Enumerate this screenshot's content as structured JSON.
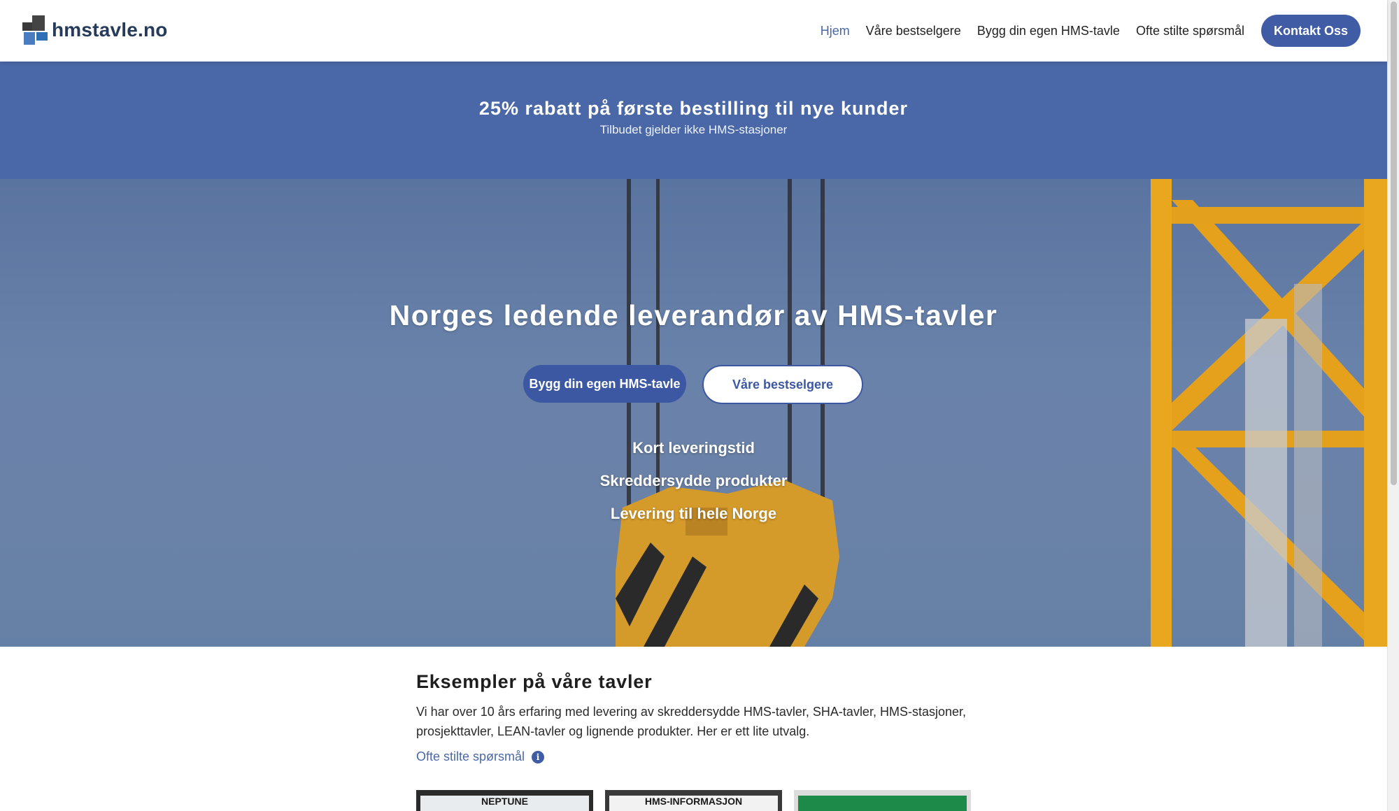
{
  "header": {
    "logo_text": "hmstavle.no",
    "nav": [
      {
        "label": "Hjem",
        "active": true
      },
      {
        "label": "Våre bestselgere",
        "active": false
      },
      {
        "label": "Bygg din egen HMS-tavle",
        "active": false
      },
      {
        "label": "Ofte stilte spørsmål",
        "active": false
      }
    ],
    "cta_label": "Kontakt Oss"
  },
  "promo": {
    "title": "25% rabatt på første bestilling til nye kunder",
    "subtitle": "Tilbudet gjelder ikke HMS-stasjoner"
  },
  "hero": {
    "title": "Norges ledende leverandør av HMS-tavler",
    "primary_button": "Bygg din egen HMS-tavle",
    "secondary_button": "Våre bestselgere",
    "features": [
      "Kort leveringstid",
      "Skreddersydde produkter",
      "Levering til hele Norge"
    ]
  },
  "examples": {
    "title": "Eksempler på våre tavler",
    "body": "Vi har over 10 års erfaring med levering av skreddersydde HMS-tavler, SHA-tavler, HMS-stasjoner, prosjekttavler, LEAN-tavler og lignende produkter. Her er ett lite utvalg.",
    "faq_link": "Ofte stilte spørsmål",
    "thumbnails": [
      "NEPTUNE",
      "HMS-INFORMASJON",
      ""
    ]
  },
  "colors": {
    "brand": "#3f5ca5",
    "promo_band": "#4a68a7",
    "link": "#4a68a8"
  },
  "icons": {
    "info": "info-circle-icon",
    "logo": "logo-squares-icon"
  }
}
